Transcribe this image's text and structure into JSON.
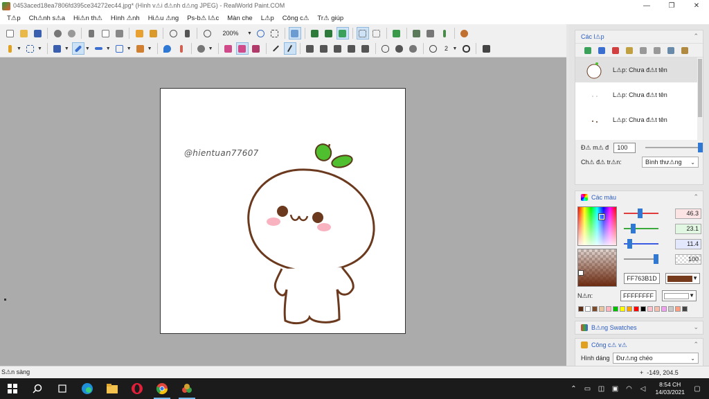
{
  "window": {
    "title": "0453aced18ea7806fd395ce34272ec44.jpg* (Hình v⚠i đ⚠nh d⚠ng JPEG) - RealWorld Paint.COM",
    "min_icon": "minimize-icon",
    "max_icon": "restore-icon",
    "close_icon": "close-icon",
    "min_glyph": "—",
    "max_glyph": "❐",
    "close_glyph": "✕"
  },
  "menu": [
    "T⚠p",
    "Ch⚠nh s⚠a",
    "Hi⚠n th⚠",
    "Hình ⚠nh",
    "Hi⚠u ⚠ng",
    "Ps-b⚠ l⚠c",
    "Màn che",
    "L⚠p",
    "Công c⚠",
    "Tr⚠ giúp"
  ],
  "toolbar": {
    "zoom_value": "200%",
    "brush_width": "2",
    "accent_color": "#2f78d3"
  },
  "canvas": {
    "watermark": "@hientuan77607"
  },
  "layers_panel": {
    "title": "Các l⚠p",
    "layers": [
      "L⚠p: Chưa đ⚠t tên",
      "L⚠p: Chưa đ⚠t tên",
      "L⚠p: Chưa đ⚠t tên"
    ],
    "opacity_label": "Đ⚠ m⚠ đ",
    "opacity_value": "100",
    "blend_label": "Ch⚠ đ⚠ tr⚠n:",
    "blend_value": "Bình thư⚠ng"
  },
  "colors_panel": {
    "title": "Các màu",
    "channels": [
      {
        "value": "46.3",
        "color": "#e23b3b",
        "level": 0.46
      },
      {
        "value": "23.1",
        "color": "#3aa83a",
        "level": 0.23
      },
      {
        "value": "11.4",
        "color": "#3b5be2",
        "level": 0.11
      },
      {
        "value": "100",
        "color": "#999999",
        "level": 1.0
      }
    ],
    "hex_value": "FF763B1D",
    "primary_color": "#763B1D",
    "secondary_label": "N⚠n:",
    "secondary_hex": "FFFFFFFF",
    "secondary_color": "#FFFFFF",
    "palette": [
      "#5b2d16",
      "#ffffff",
      "#7a4a2a",
      "#e8c7a0",
      "#ffb6c1",
      "#00c000",
      "#ffff00",
      "#ffa500",
      "#ff0000",
      "#000000",
      "#ffc0cb",
      "#f5c0b0",
      "#f0a0f0",
      "#c8c8c8",
      "#ff9f80",
      "#444444"
    ]
  },
  "swatches_panel": {
    "title": "B⚠ng Swatches"
  },
  "tool_panel": {
    "title": "Công c⚠ v⚠",
    "shape_label": "Hình dáng",
    "shape_value": "Đư⚠ng chéo"
  },
  "status": {
    "text": "S⚠n sàng",
    "coords": "-149, 204.5"
  },
  "taskbar": {
    "time": "8:54 CH",
    "date": "14/03/2021"
  }
}
